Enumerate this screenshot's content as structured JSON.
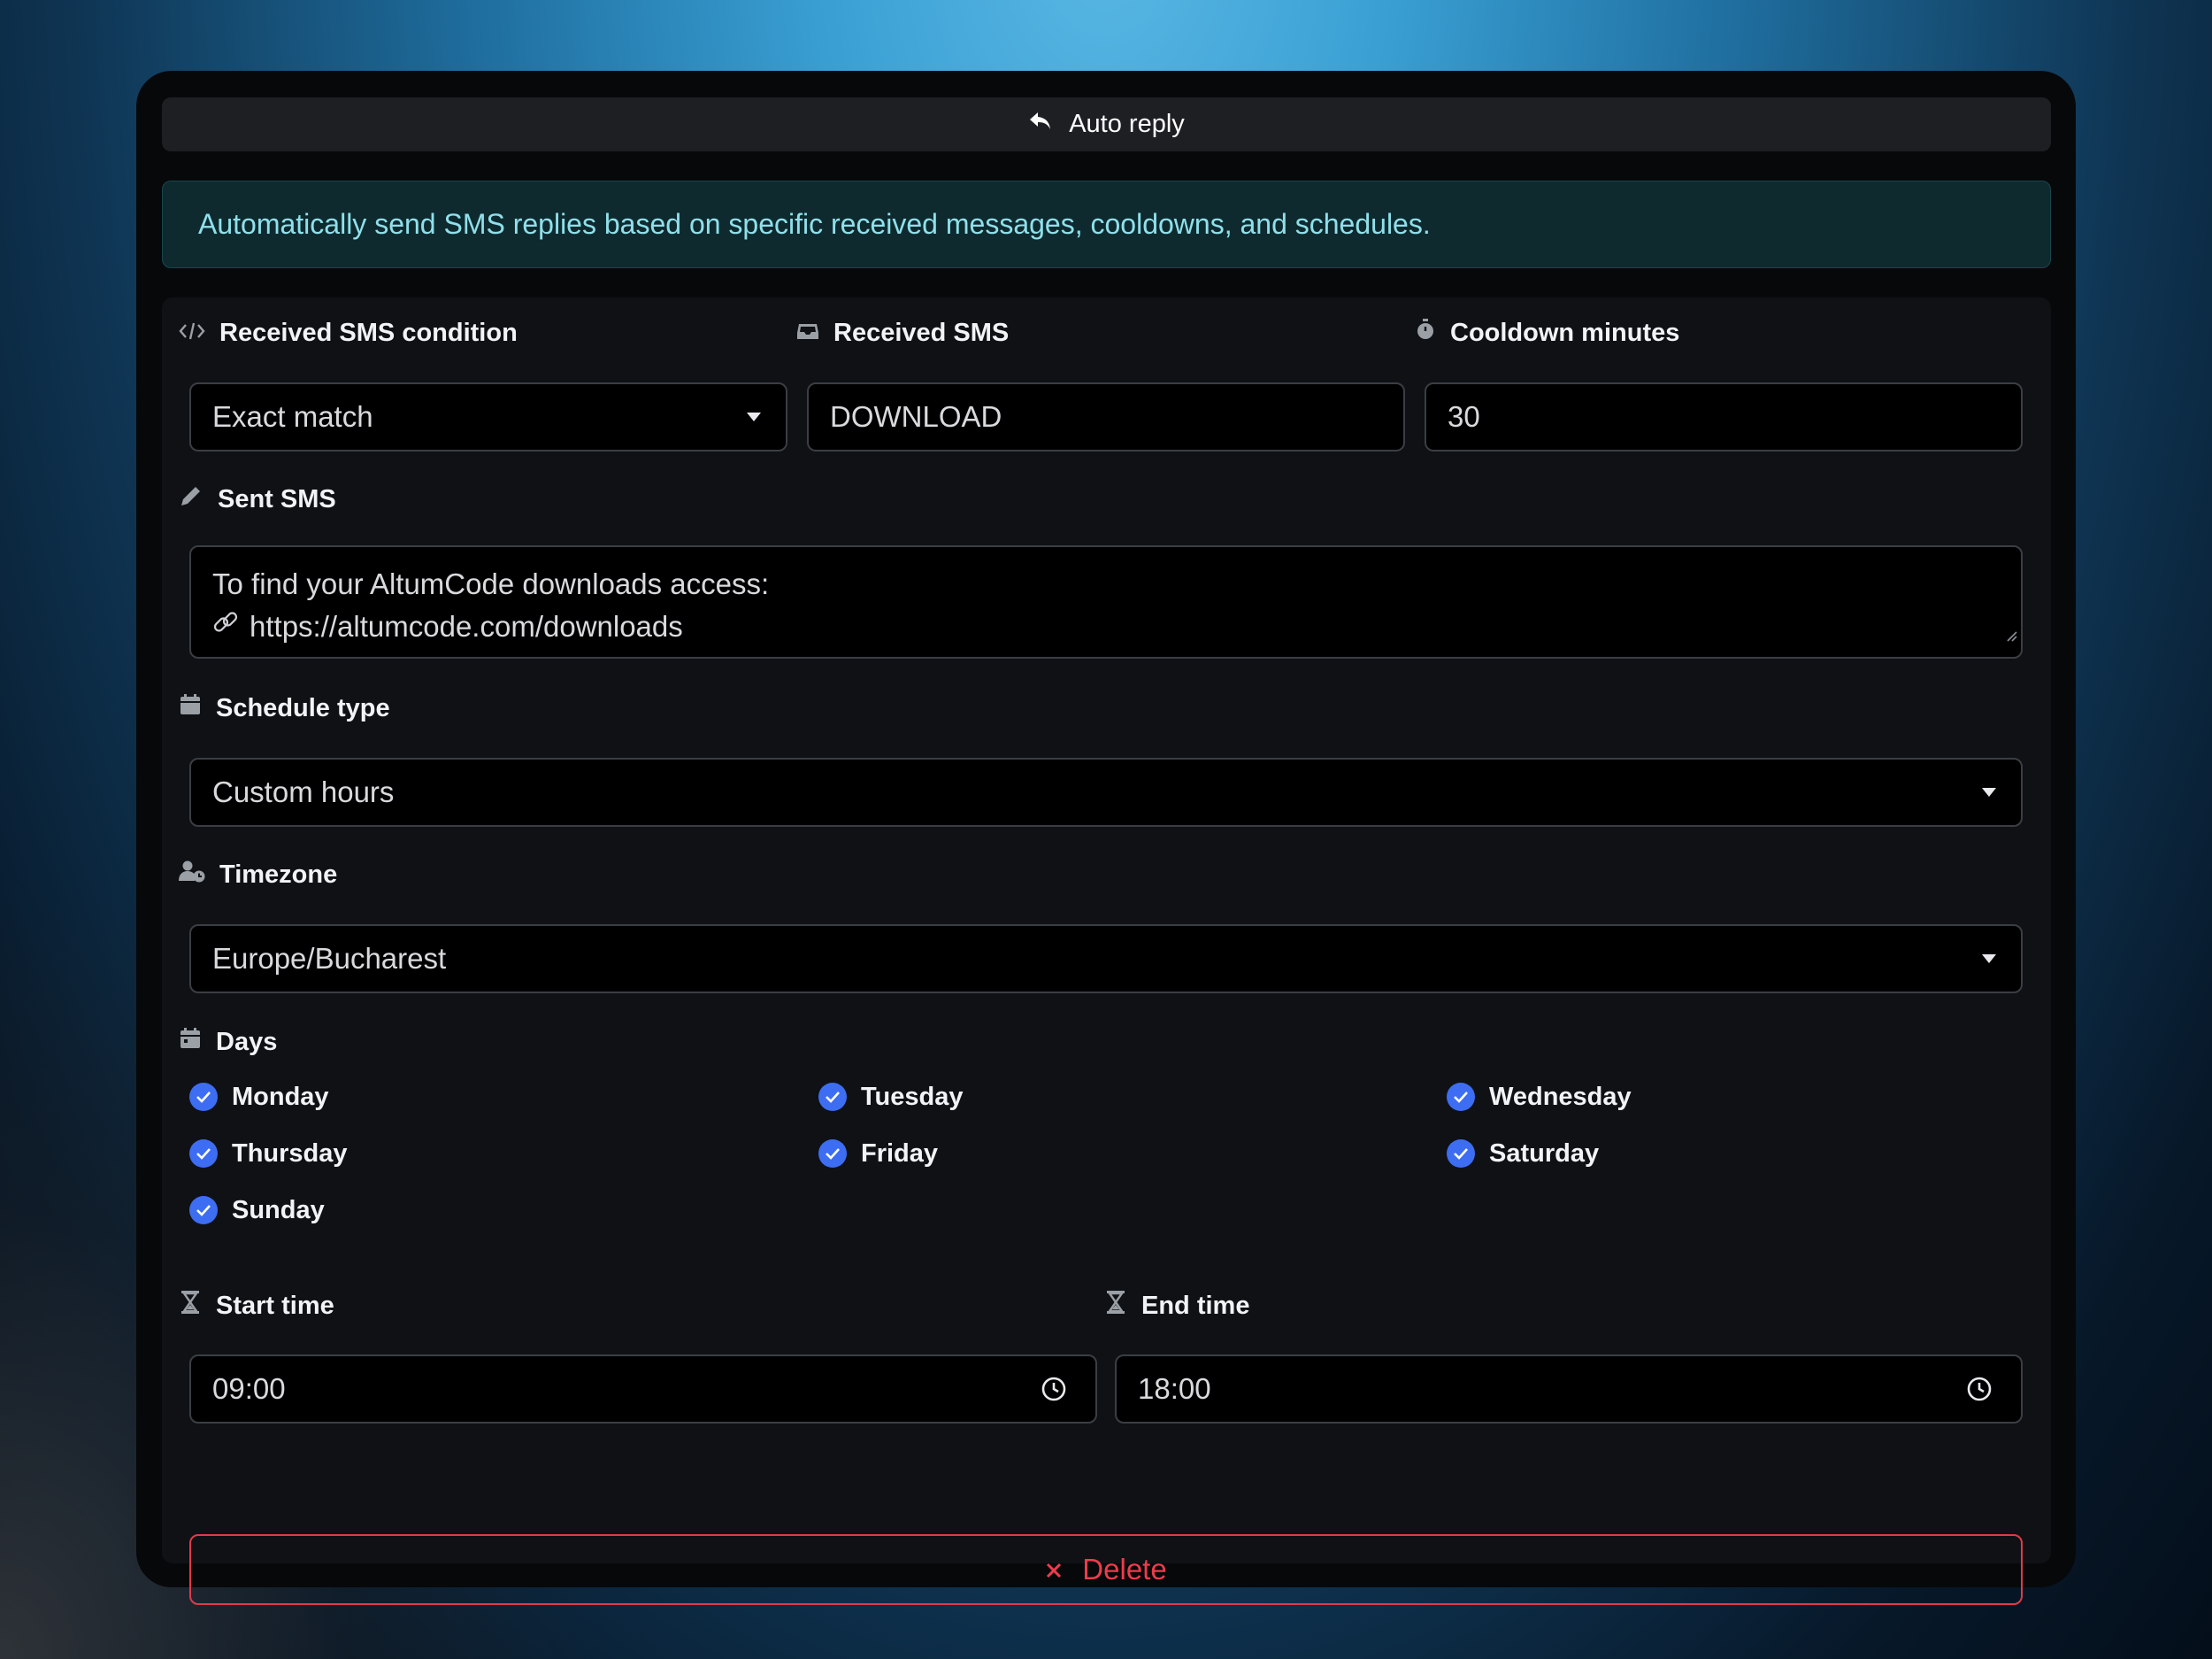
{
  "header": {
    "title": "Auto reply"
  },
  "alert": {
    "text": "Automatically send SMS replies based on specific received messages, cooldowns, and schedules."
  },
  "condition": {
    "label": "Received SMS condition",
    "value": "Exact match"
  },
  "received": {
    "label": "Received SMS",
    "value": "DOWNLOAD"
  },
  "cooldown": {
    "label": "Cooldown minutes",
    "value": "30"
  },
  "sent": {
    "label": "Sent SMS",
    "line1": "To find your AltumCode downloads access:",
    "line2": "https://altumcode.com/downloads"
  },
  "schedule": {
    "label": "Schedule type",
    "value": "Custom hours"
  },
  "timezone": {
    "label": "Timezone",
    "value": "Europe/Bucharest"
  },
  "days": {
    "label": "Days",
    "items": [
      {
        "name": "Monday",
        "checked": true
      },
      {
        "name": "Tuesday",
        "checked": true
      },
      {
        "name": "Wednesday",
        "checked": true
      },
      {
        "name": "Thursday",
        "checked": true
      },
      {
        "name": "Friday",
        "checked": true
      },
      {
        "name": "Saturday",
        "checked": true
      },
      {
        "name": "Sunday",
        "checked": true
      }
    ]
  },
  "start": {
    "label": "Start time",
    "value": "09:00"
  },
  "end": {
    "label": "End time",
    "value": "18:00"
  },
  "delete": {
    "label": "Delete"
  },
  "colors": {
    "accent": "#3d6df2",
    "danger": "#e03b49",
    "info_text": "#8fe0ea",
    "info_bg": "#0e2a2f"
  }
}
